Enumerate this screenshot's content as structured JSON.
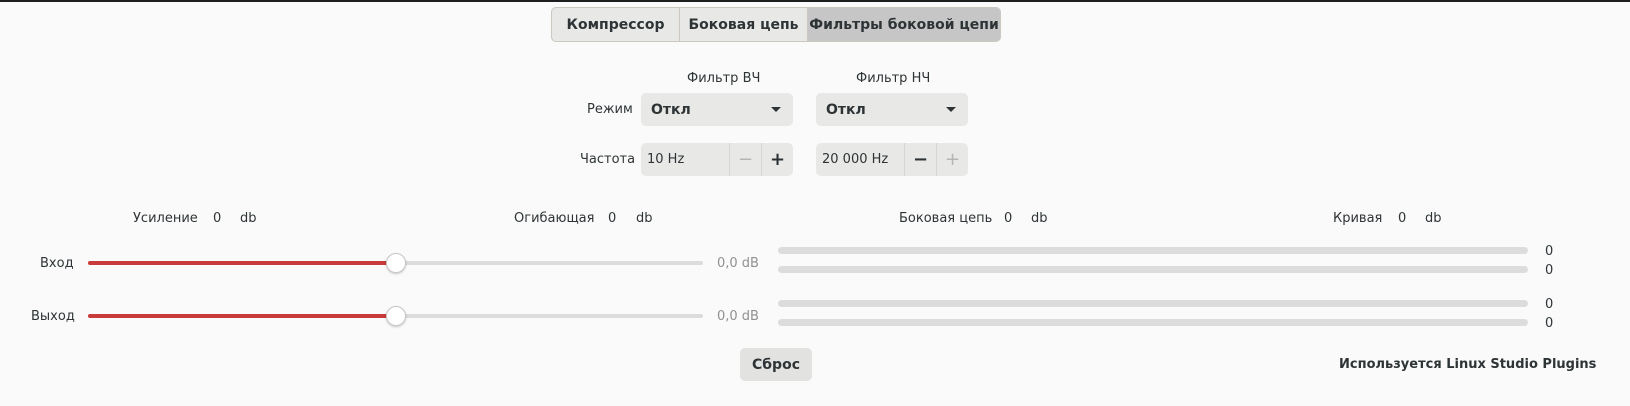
{
  "tabs": [
    {
      "label": "Компрессор",
      "active": false
    },
    {
      "label": "Боковая цепь",
      "active": false
    },
    {
      "label": "Фильтры боковой цепи",
      "active": true
    }
  ],
  "filters": {
    "hp_title": "Фильтр ВЧ",
    "lp_title": "Фильтр НЧ",
    "mode_label": "Режим",
    "freq_label": "Частота",
    "hp_mode": "Откл",
    "lp_mode": "Откл",
    "hp_freq": "10 Hz",
    "lp_freq": "20 000 Hz",
    "minus": "−",
    "plus": "+"
  },
  "levels": {
    "gain_label": "Усиление",
    "gain_value": "0",
    "envelope_label": "Огибающая",
    "envelope_value": "0",
    "sidechain_label": "Боковая цепь",
    "sidechain_value": "0",
    "curve_label": "Кривая",
    "curve_value": "0",
    "unit": "db"
  },
  "io": {
    "input_label": "Вход",
    "input_value": "0,0 dB",
    "input_level": 0.5,
    "output_label": "Выход",
    "output_value": "0,0 dB",
    "output_level": 0.5
  },
  "meters": [
    "0",
    "0",
    "0",
    "0"
  ],
  "reset_label": "Сброс",
  "credit": "Используется Linux Studio Plugins",
  "colors": {
    "accent": "#c93a3a"
  }
}
